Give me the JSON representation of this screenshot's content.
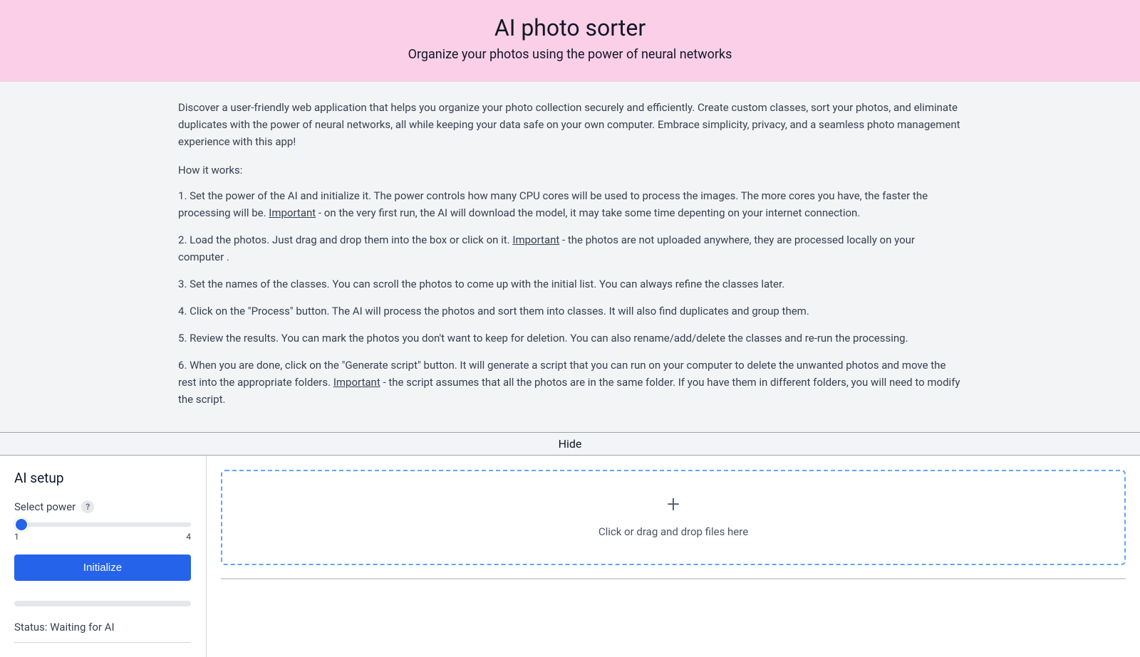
{
  "header": {
    "title": "AI photo sorter",
    "subtitle": "Organize your photos using the power of neural networks"
  },
  "intro": {
    "description": "Discover a user-friendly web application that helps you organize your photo collection securely and efficiently. Create custom classes, sort your photos, and eliminate duplicates with the power of neural networks, all while keeping your data safe on your own computer. Embrace simplicity, privacy, and a seamless photo management experience with this app!",
    "how_label": "How it works:",
    "important_word": "Important",
    "steps": [
      {
        "pre": "Set the power of the AI and initialize it. The power controls how many CPU cores will be used to process the images. The more cores you have, the faster the processing will be. ",
        "post": " - on the very first run, the AI will download the model, it may take some time depenting on your internet connection."
      },
      {
        "pre": "Load the photos. Just drag and drop them into the box or click on it. ",
        "post": " - the photos are not uploaded anywhere, they are processed locally on your computer ."
      },
      {
        "pre": "Set the names of the classes. You can scroll the photos to come up with the initial list. You can always refine the classes later.",
        "post": ""
      },
      {
        "pre": "Click on the \"Process\" button. The AI will process the photos and sort them into classes. It will also find duplicates and group them.",
        "post": ""
      },
      {
        "pre": "Review the results. You can mark the photos you don't want to keep for deletion. You can also rename/add/delete the classes and re-run the processing.",
        "post": ""
      },
      {
        "pre": "When you are done, click on the \"Generate script\" button. It will generate a script that you can run on your computer to delete the unwanted photos and move the rest into the appropriate folders. ",
        "post": " - the script assumes that all the photos are in the same folder. If you have them in different folders, you will need to modify the script."
      }
    ]
  },
  "hide_label": "Hide",
  "sidebar": {
    "title": "AI setup",
    "power_label": "Select power",
    "help_symbol": "?",
    "slider_min": "1",
    "slider_max": "4",
    "init_button": "Initialize",
    "status_text": "Status: Waiting for AI"
  },
  "dropzone": {
    "plus": "+",
    "text": "Click or drag and drop files here"
  }
}
